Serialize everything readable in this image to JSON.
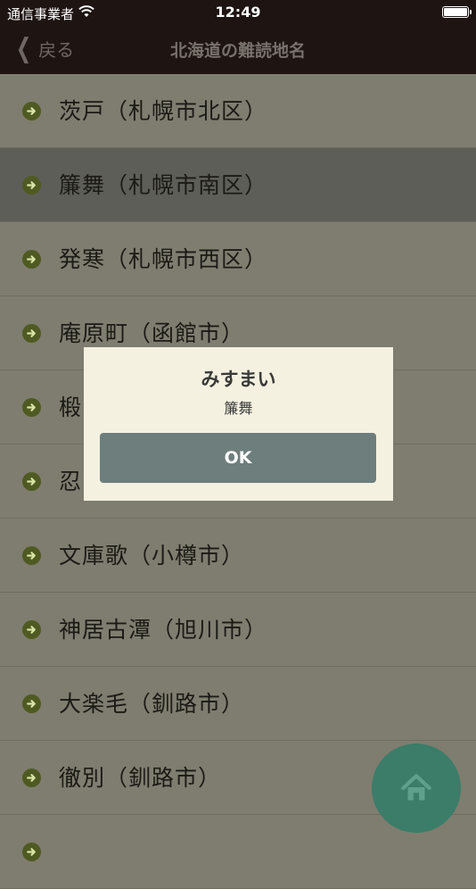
{
  "status": {
    "carrier": "通信事業者",
    "time": "12:49"
  },
  "nav": {
    "back_label": "戻る",
    "title": "北海道の難読地名"
  },
  "list": {
    "items": [
      {
        "label": "茨戸（札幌市北区）"
      },
      {
        "label": "簾舞（札幌市南区）"
      },
      {
        "label": "発寒（札幌市西区）"
      },
      {
        "label": "庵原町（函館市）"
      },
      {
        "label": "椴"
      },
      {
        "label": "忍"
      },
      {
        "label": "文庫歌（小樽市）"
      },
      {
        "label": "神居古潭（旭川市）"
      },
      {
        "label": "大楽毛（釧路市）"
      },
      {
        "label": "徹別（釧路市）"
      },
      {
        "label": ""
      }
    ]
  },
  "dialog": {
    "title": "みすまい",
    "message": "簾舞",
    "ok_label": "OK"
  },
  "colors": {
    "accent": "#3b7d69",
    "header": "#1e1412",
    "row_bg": "#7f7d6f"
  }
}
